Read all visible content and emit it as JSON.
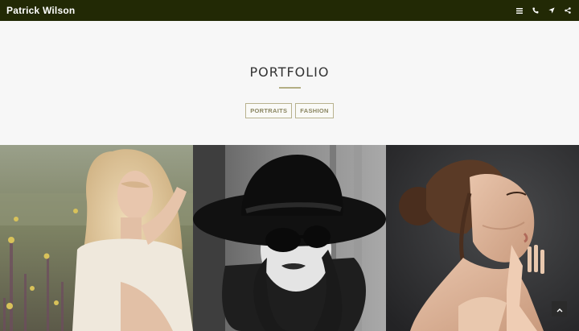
{
  "header": {
    "brand": "Patrick Wilson",
    "icons": [
      "menu-icon",
      "phone-icon",
      "location-arrow-icon",
      "share-icon"
    ],
    "background": "#222905"
  },
  "portfolio": {
    "title": "PORTFOLIO",
    "filters": [
      {
        "label": "PORTRAITS"
      },
      {
        "label": "FASHION"
      }
    ],
    "accent": "#b3ae84"
  },
  "gallery": {
    "items": [
      {
        "name": "blonde-woman-in-field"
      },
      {
        "name": "woman-in-black-hat-and-sunglasses"
      },
      {
        "name": "woman-with-hair-bun-profile"
      }
    ]
  },
  "back_to_top": {
    "icon": "chevron-up-icon"
  }
}
